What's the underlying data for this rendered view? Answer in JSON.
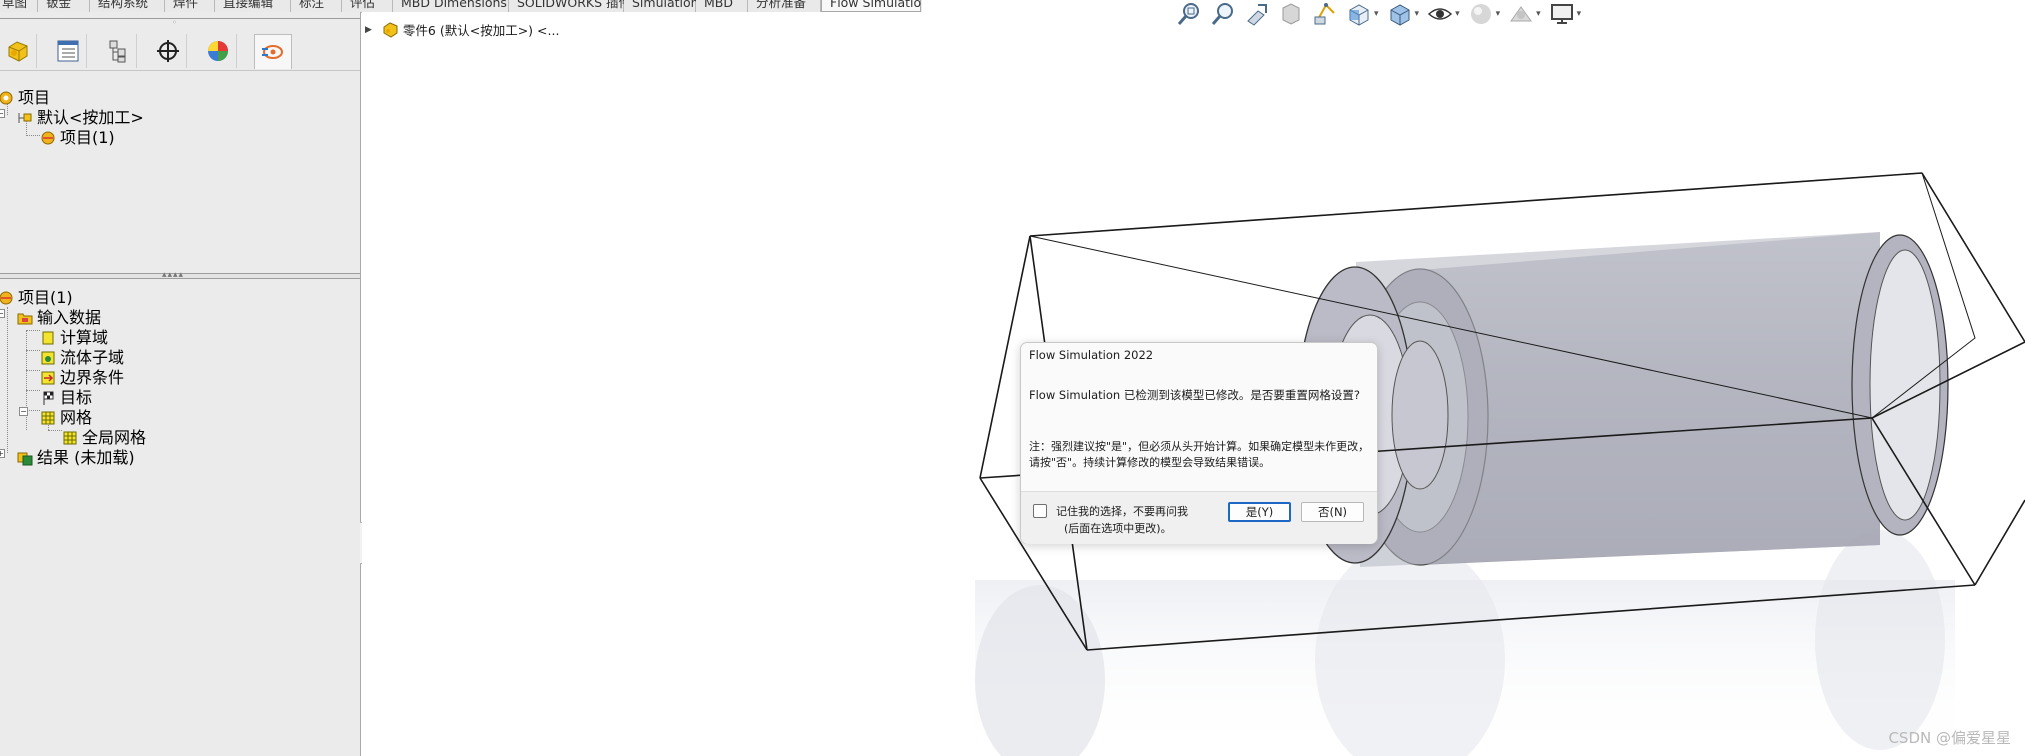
{
  "tabs": [
    {
      "label": "草图",
      "active": false
    },
    {
      "label": "钣金",
      "active": false
    },
    {
      "label": "结构系统",
      "active": false
    },
    {
      "label": "焊件",
      "active": false
    },
    {
      "label": "直接编辑",
      "active": false
    },
    {
      "label": "标注",
      "active": false
    },
    {
      "label": "评估",
      "active": false
    },
    {
      "label": "MBD Dimensions",
      "active": false
    },
    {
      "label": "SOLIDWORKS 插件",
      "active": false
    },
    {
      "label": "Simulation",
      "active": false
    },
    {
      "label": "MBD",
      "active": false
    },
    {
      "label": "分析准备",
      "active": false
    },
    {
      "label": "Flow Simulation",
      "active": true
    }
  ],
  "manager_icons": [
    "part-feature-icon",
    "property-manager-icon",
    "configuration-manager-icon",
    "dimxpert-icon",
    "display-manager-icon",
    "flow-simulation-icon"
  ],
  "tree_top": {
    "root": "项目",
    "config": "默认<按加工>",
    "project": "项目(1)"
  },
  "tree_bottom": {
    "root": "项目(1)",
    "input": "输入数据",
    "items": [
      "计算域",
      "流体子域",
      "边界条件",
      "目标",
      "网格"
    ],
    "mesh_child": "全局网格",
    "results": "结果 (未加载)"
  },
  "viewport": {
    "breadcrumb": "零件6 (默认<按加工>) <..."
  },
  "dialog": {
    "title": "Flow Simulation 2022",
    "message": "Flow Simulation 已检测到该模型已修改。是否要重置网格设置?",
    "note": "注：强烈建议按\"是\"，但必须从头开始计算。如果确定模型未作更改，请按\"否\"。持续计算修改的模型会导致结果错误。",
    "checkbox_label": "记住我的选择，不要再问我",
    "checkbox_hint": "(后面在选项中更改)。",
    "yes": "是(Y)",
    "no": "否(N)"
  },
  "watermark": "CSDN @偏爱星星",
  "colors": {
    "accent": "#1f67c4",
    "panel": "#ebebeb"
  }
}
